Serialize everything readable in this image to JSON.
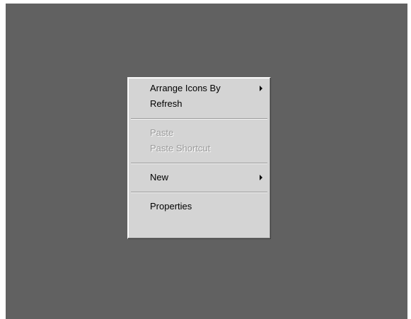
{
  "context_menu": {
    "items": [
      {
        "label": "Arrange Icons By",
        "enabled": true,
        "submenu": true,
        "icon": "chevron-right-icon"
      },
      {
        "label": "Refresh",
        "enabled": true,
        "submenu": false
      },
      {
        "label": "Paste",
        "enabled": false,
        "submenu": false
      },
      {
        "label": "Paste Shortcut",
        "enabled": false,
        "submenu": false
      },
      {
        "label": "New",
        "enabled": true,
        "submenu": true,
        "icon": "chevron-right-icon"
      },
      {
        "label": "Properties",
        "enabled": true,
        "submenu": false
      }
    ]
  },
  "colors": {
    "desktop_background": "#616161",
    "menu_background": "#d4d4d4",
    "enabled_text": "#000000",
    "disabled_text": "#9a9a9a"
  }
}
